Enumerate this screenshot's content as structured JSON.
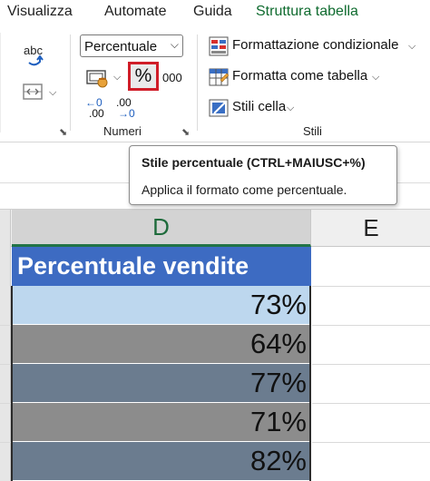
{
  "tabs": [
    "Visualizza",
    "Automate",
    "Guida",
    "Struttura tabella"
  ],
  "ribbon": {
    "number_format": "Percentuale",
    "percent_symbol": "%",
    "thousands_label": "000",
    "groups": {
      "numbers": "Numeri",
      "styles": "Stili"
    },
    "styles": {
      "conditional_formatting": "Formattazione condizionale",
      "format_as_table": "Formatta come tabella",
      "cell_styles": "Stili cella"
    },
    "decimal_icon_text": {
      "increase_top": "←0",
      "increase_bottom": ".00",
      "decrease_top": ".00",
      "decrease_bottom": "→0"
    },
    "spelling_icon_text": "abc"
  },
  "tooltip": {
    "title": "Stile percentuale (CTRL+MAIUSC+%)",
    "description": "Applica il formato come percentuale."
  },
  "sheet": {
    "columns": [
      "D",
      "E"
    ],
    "selected_column": "D",
    "header": "Percentuale vendite",
    "rows": [
      {
        "value": "73%",
        "fill": "#bdd7ee"
      },
      {
        "value": "64%",
        "fill": "#8c8c8c"
      },
      {
        "value": "77%",
        "fill": "#6b7c8f"
      },
      {
        "value": "71%",
        "fill": "#8c8c8c"
      },
      {
        "value": "82%",
        "fill": "#6b7c8f"
      }
    ],
    "colors": {
      "header_fill": "#3d6bc2",
      "selection_accent": "#217346",
      "highlight_border": "#d01d28"
    }
  }
}
